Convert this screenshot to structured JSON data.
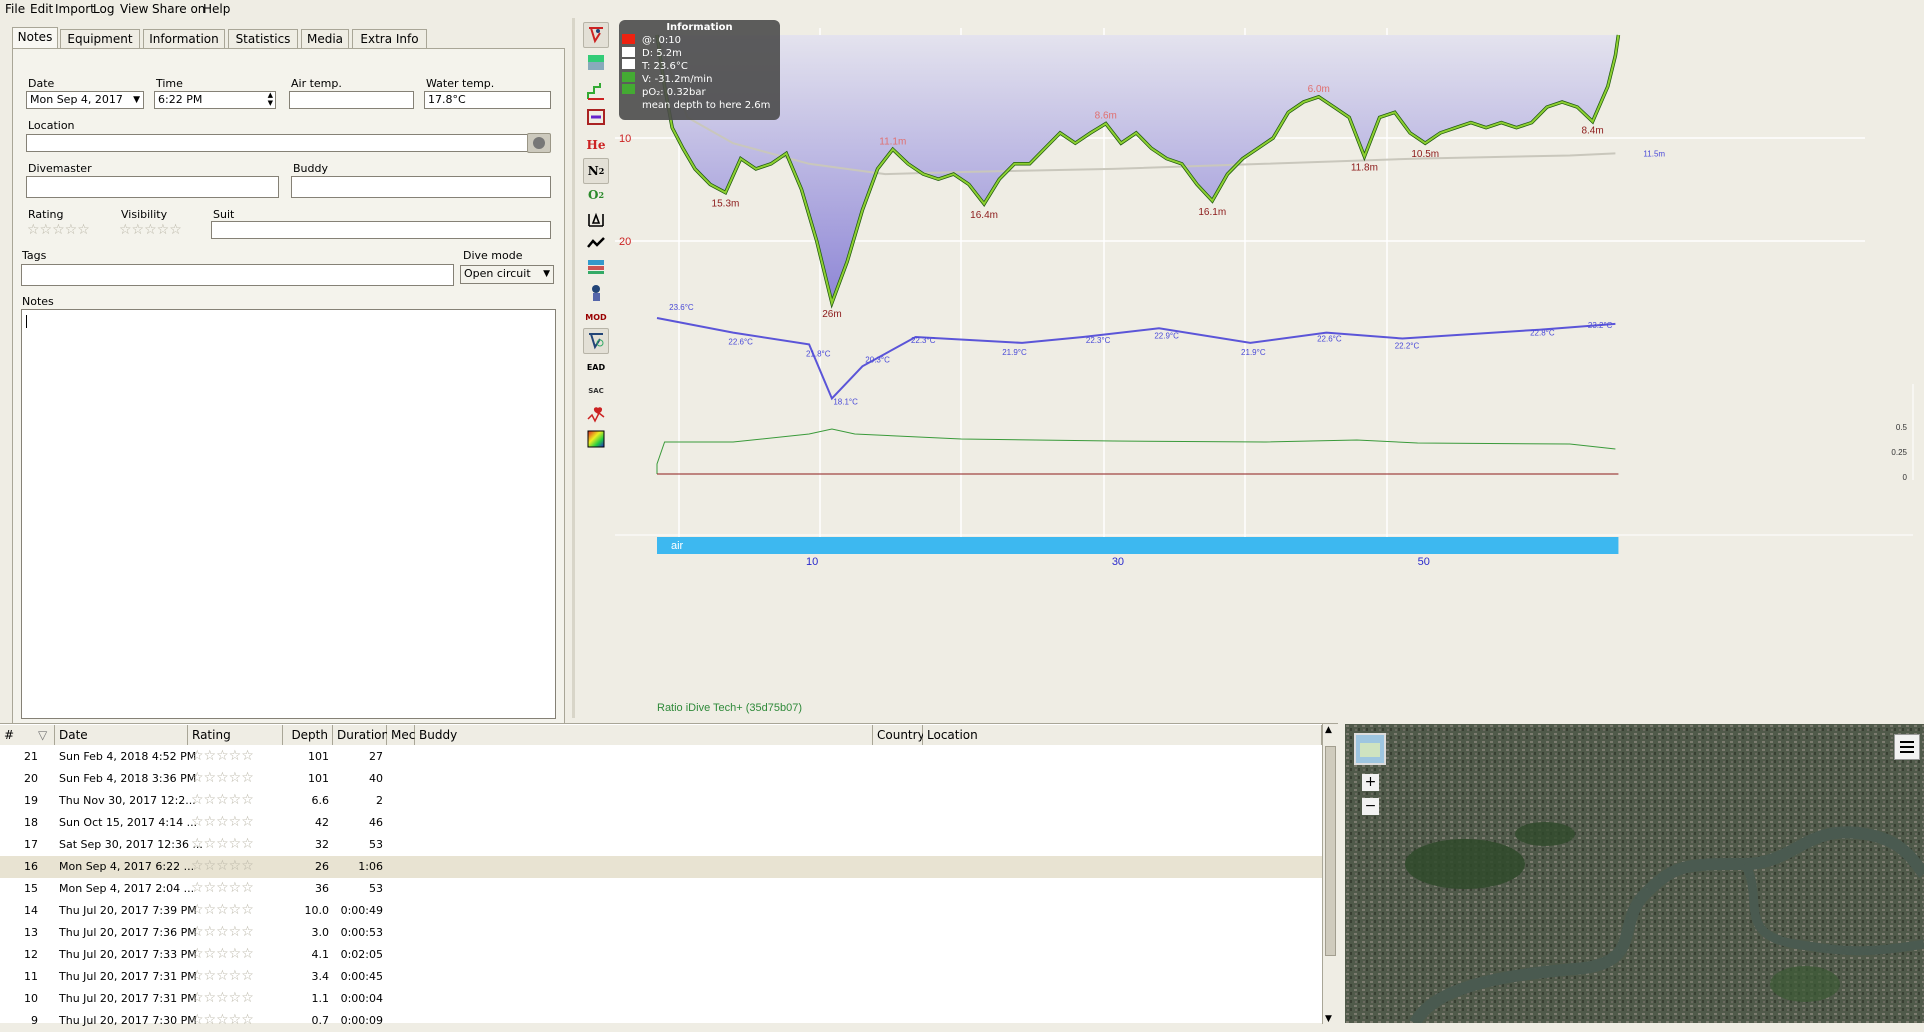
{
  "menu": {
    "items": [
      "File",
      "Edit",
      "Import",
      "Log",
      "View",
      "Share on",
      "Help"
    ]
  },
  "tabs": [
    "Notes",
    "Equipment",
    "Information",
    "Statistics",
    "Media",
    "Extra Info"
  ],
  "notes": {
    "date_label": "Date",
    "date_value": "Mon Sep 4, 2017",
    "time_label": "Time",
    "time_value": "6:22 PM",
    "airtemp_label": "Air temp.",
    "airtemp_value": "",
    "watertemp_label": "Water temp.",
    "watertemp_value": "17.8°C",
    "location_label": "Location",
    "location_value": "",
    "divemaster_label": "Divemaster",
    "divemaster_value": "",
    "buddy_label": "Buddy",
    "buddy_value": "",
    "rating_label": "Rating",
    "visibility_label": "Visibility",
    "suit_label": "Suit",
    "suit_value": "",
    "tags_label": "Tags",
    "tags_value": "",
    "divemode_label": "Dive mode",
    "divemode_value": "Open circuit",
    "notes_label": "Notes",
    "notes_value": ""
  },
  "toolbar": {
    "icons": [
      "calc-ceiling-icon",
      "ceiling-shaded-icon",
      "deco-ceiling-icon",
      "tissue-graph-icon",
      "he-icon",
      "n2-icon",
      "o2-icon",
      "delta-icon",
      "heartrate-line-icon",
      "gas-bars-icon",
      "dive-computer-icon",
      "mod-icon",
      "profile-icon",
      "ead-icon",
      "sac-icon",
      "heartbeat-icon",
      "heatmap-icon"
    ],
    "labels": {
      "he": "He",
      "n2": "N",
      "o2": "O",
      "mod": "MOD",
      "ead": "EAD",
      "sac": "SAC"
    }
  },
  "info_box": {
    "title": "Information",
    "lines": [
      "@: 0:10",
      "D: 5.2m",
      "T: 23.6°C",
      "V: -31.2m/min",
      "pO₂: 0.32bar",
      "mean depth to here 2.6m"
    ]
  },
  "chart_data": {
    "type": "area",
    "depth_axis_ticks": [
      "10",
      "20"
    ],
    "time_axis_ticks": [
      "10",
      "30",
      "50"
    ],
    "depth_labels": [
      "15.3m",
      "26m",
      "11.1m",
      "16.4m",
      "8.6m",
      "16.1m",
      "6.0m",
      "11.8m",
      "10.5m",
      "8.4m",
      "11.5m"
    ],
    "temp_labels": [
      "23.6°C",
      "22.6°C",
      "21.8°C",
      "18.1°C",
      "20.3°C",
      "22.3°C",
      "21.9°C",
      "22.3°C",
      "22.9°C",
      "21.9°C",
      "22.6°C",
      "22.2°C",
      "22.8°C",
      "23.2°C"
    ],
    "po2_ticks": [
      "0.5",
      "0.25",
      "0"
    ],
    "gas_label": "air",
    "computer_label": "Ratio iDive Tech+ (35d75b07)",
    "depth_profile": [
      [
        0,
        0
      ],
      [
        0.5,
        5
      ],
      [
        1,
        9
      ],
      [
        1.7,
        11
      ],
      [
        2.5,
        13
      ],
      [
        3.5,
        14.5
      ],
      [
        4.5,
        15.3
      ],
      [
        5.5,
        12
      ],
      [
        6.5,
        13
      ],
      [
        7.5,
        12.5
      ],
      [
        8.5,
        11.5
      ],
      [
        9.5,
        15
      ],
      [
        10.5,
        20
      ],
      [
        11.5,
        26
      ],
      [
        12.5,
        22
      ],
      [
        13.5,
        17
      ],
      [
        14.5,
        13
      ],
      [
        15.5,
        11.1
      ],
      [
        16.5,
        12.5
      ],
      [
        17.5,
        13.5
      ],
      [
        18.5,
        14
      ],
      [
        19.5,
        13.5
      ],
      [
        20.5,
        14.5
      ],
      [
        21.5,
        16.4
      ],
      [
        22.5,
        14
      ],
      [
        23.5,
        12.5
      ],
      [
        24.5,
        12.5
      ],
      [
        25.5,
        11
      ],
      [
        26.5,
        9.5
      ],
      [
        27.5,
        10.5
      ],
      [
        28.5,
        9.5
      ],
      [
        29.5,
        8.6
      ],
      [
        30.5,
        10.5
      ],
      [
        31.5,
        9.5
      ],
      [
        32.5,
        11
      ],
      [
        33.5,
        12
      ],
      [
        34.5,
        12.5
      ],
      [
        35.5,
        14.5
      ],
      [
        36.5,
        16.1
      ],
      [
        37.5,
        13.5
      ],
      [
        38.5,
        12
      ],
      [
        39.5,
        11
      ],
      [
        40.5,
        10
      ],
      [
        41.5,
        7.5
      ],
      [
        42.5,
        6.5
      ],
      [
        43.5,
        6.0
      ],
      [
        44.5,
        7
      ],
      [
        45.5,
        8
      ],
      [
        46.5,
        11.8
      ],
      [
        47.5,
        8
      ],
      [
        48.5,
        7.5
      ],
      [
        49.5,
        9.5
      ],
      [
        50.5,
        10.5
      ],
      [
        51.5,
        9.5
      ],
      [
        52.5,
        9
      ],
      [
        53.5,
        8.5
      ],
      [
        54.5,
        9
      ],
      [
        55.5,
        8.5
      ],
      [
        56.5,
        9
      ],
      [
        57.5,
        8.5
      ],
      [
        58.5,
        7
      ],
      [
        59.5,
        6.5
      ],
      [
        60.5,
        7
      ],
      [
        61.5,
        8.4
      ],
      [
        62.5,
        5
      ],
      [
        63,
        2
      ],
      [
        63.2,
        0
      ]
    ],
    "temp_profile": [
      [
        0,
        23.6
      ],
      [
        5,
        22.6
      ],
      [
        10,
        21.8
      ],
      [
        11.5,
        18.1
      ],
      [
        13.5,
        20.3
      ],
      [
        17,
        22.3
      ],
      [
        24,
        21.9
      ],
      [
        28,
        22.3
      ],
      [
        33,
        22.9
      ],
      [
        39,
        21.9
      ],
      [
        44,
        22.6
      ],
      [
        49,
        22.2
      ],
      [
        58,
        22.8
      ],
      [
        63,
        23.2
      ]
    ],
    "mean_depth_profile": [
      [
        0,
        0
      ],
      [
        2,
        8
      ],
      [
        5,
        10.5
      ],
      [
        10,
        12.5
      ],
      [
        15,
        13.5
      ],
      [
        20,
        13.3
      ],
      [
        30,
        13
      ],
      [
        40,
        12.5
      ],
      [
        50,
        12
      ],
      [
        60,
        11.7
      ],
      [
        63,
        11.5
      ]
    ],
    "po2_profile": [
      [
        0,
        0.1
      ],
      [
        0.5,
        0.32
      ],
      [
        5,
        0.32
      ],
      [
        10,
        0.4
      ],
      [
        11.5,
        0.45
      ],
      [
        13,
        0.4
      ],
      [
        20,
        0.35
      ],
      [
        30,
        0.33
      ],
      [
        40,
        0.32
      ],
      [
        46,
        0.34
      ],
      [
        50,
        0.31
      ],
      [
        60,
        0.3
      ],
      [
        63,
        0.25
      ]
    ],
    "xlim": [
      0,
      66
    ],
    "ylim": [
      0,
      28
    ]
  },
  "divelist": {
    "headers": [
      "#",
      "Date",
      "Rating",
      "Depth",
      "Duration",
      "Mec",
      "Buddy",
      "Country",
      "Location"
    ],
    "rows": [
      {
        "num": "21",
        "date": "Sun Feb 4, 2018 4:52 PM",
        "depth": "101",
        "duration": "27"
      },
      {
        "num": "20",
        "date": "Sun Feb 4, 2018 3:36 PM",
        "depth": "101",
        "duration": "40"
      },
      {
        "num": "19",
        "date": "Thu Nov 30, 2017 12:2...",
        "depth": "6.6",
        "duration": "2"
      },
      {
        "num": "18",
        "date": "Sun Oct 15, 2017 4:14 ...",
        "depth": "42",
        "duration": "46"
      },
      {
        "num": "17",
        "date": "Sat Sep 30, 2017 12:36 ...",
        "depth": "32",
        "duration": "53"
      },
      {
        "num": "16",
        "date": "Mon Sep 4, 2017 6:22 ...",
        "depth": "26",
        "duration": "1:06"
      },
      {
        "num": "15",
        "date": "Mon Sep 4, 2017 2:04 ...",
        "depth": "36",
        "duration": "53"
      },
      {
        "num": "14",
        "date": "Thu Jul 20, 2017 7:39 PM",
        "depth": "10.0",
        "duration": "0:00:49"
      },
      {
        "num": "13",
        "date": "Thu Jul 20, 2017 7:36 PM",
        "depth": "3.0",
        "duration": "0:00:53"
      },
      {
        "num": "12",
        "date": "Thu Jul 20, 2017 7:33 PM",
        "depth": "4.1",
        "duration": "0:02:05"
      },
      {
        "num": "11",
        "date": "Thu Jul 20, 2017 7:31 PM",
        "depth": "3.4",
        "duration": "0:00:45"
      },
      {
        "num": "10",
        "date": "Thu Jul 20, 2017 7:31 PM",
        "depth": "1.1",
        "duration": "0:00:04"
      },
      {
        "num": "9",
        "date": "Thu Jul 20, 2017 7:30 PM",
        "depth": "0.7",
        "duration": "0:00:09"
      }
    ],
    "rating_stars": "☆☆☆☆☆"
  },
  "map": {
    "zoom_in": "+",
    "zoom_out": "−"
  },
  "colors": {
    "depth_fill": "#8f88d8",
    "temp_line": "#5b55d8",
    "po2_line": "#3a9a3a",
    "depth_label": "#8c1a1a",
    "gas_bar": "#3db8f0",
    "axis_blue": "#2a2acc"
  }
}
